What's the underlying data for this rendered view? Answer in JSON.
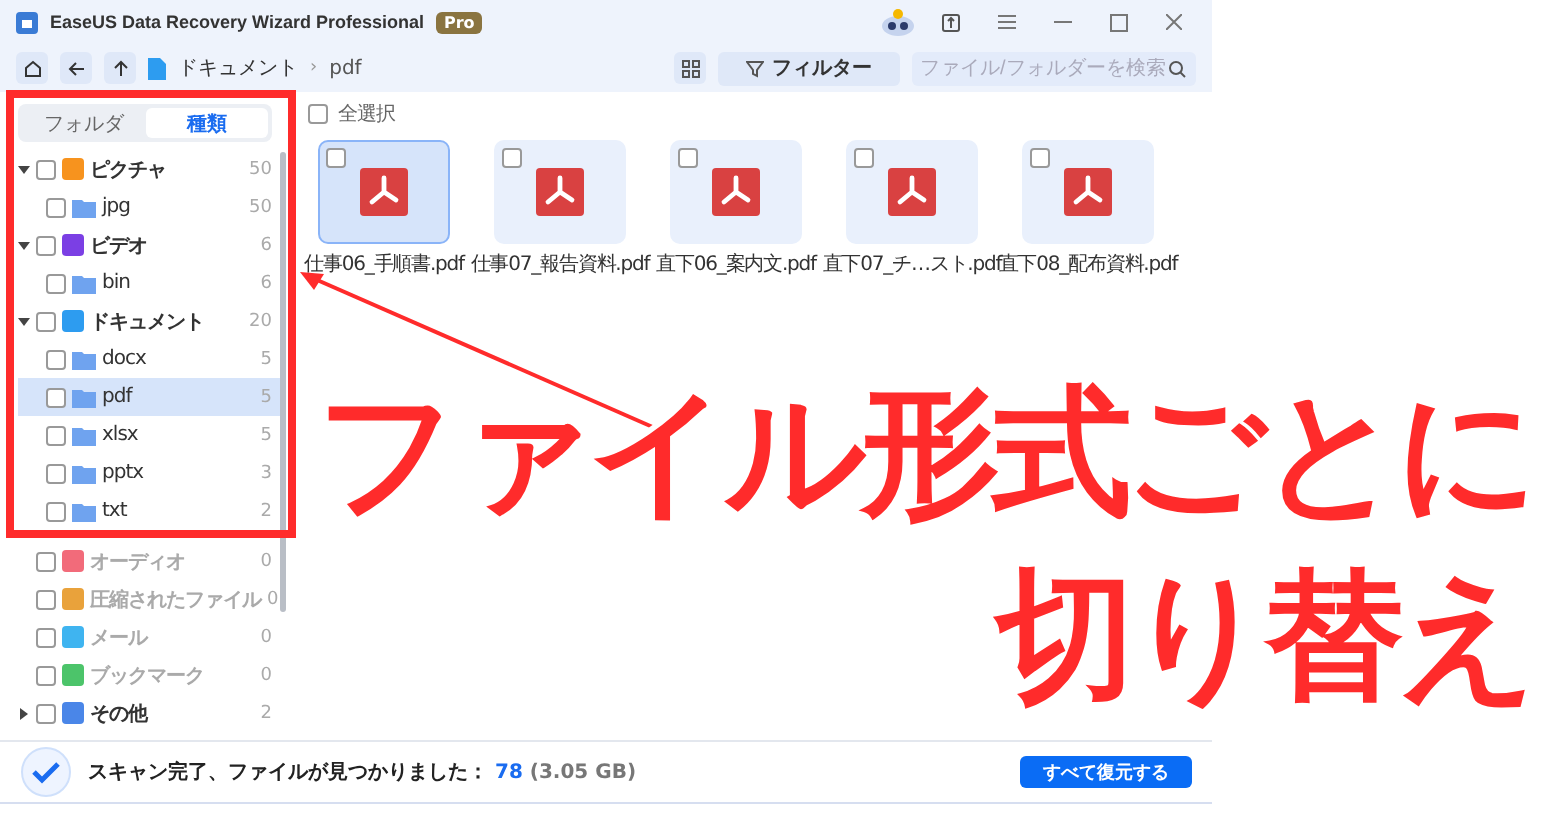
{
  "window": {
    "title": "EaseUS Data Recovery Wizard Professional",
    "badge": "Pro"
  },
  "toolbar": {
    "breadcrumb": [
      "ドキュメント",
      "pdf"
    ],
    "breadcrumb_separator": "›",
    "filter_button": "フィルター",
    "search": {
      "placeholder": "ファイル/フォルダーを検索"
    }
  },
  "sidebar": {
    "tabs": [
      {
        "label": "フォルダ",
        "selected": false
      },
      {
        "label": "種類",
        "selected": true
      }
    ],
    "tree": [
      {
        "label": "ピクチャ",
        "count": "50",
        "color": "#f7931e",
        "expanded": true,
        "checked": false,
        "disabled": false,
        "selected": false,
        "children": [
          {
            "label": "jpg",
            "count": "50",
            "checked": false,
            "selected": false
          }
        ]
      },
      {
        "label": "ビデオ",
        "count": "6",
        "color": "#7b3fe4",
        "expanded": true,
        "checked": false,
        "disabled": false,
        "selected": false,
        "children": [
          {
            "label": "bin",
            "count": "6",
            "checked": false,
            "selected": false
          }
        ]
      },
      {
        "label": "ドキュメント",
        "count": "20",
        "color": "#2d9cf0",
        "expanded": true,
        "checked": false,
        "disabled": false,
        "selected": false,
        "children": [
          {
            "label": "docx",
            "count": "5",
            "checked": false,
            "selected": false
          },
          {
            "label": "pdf",
            "count": "5",
            "checked": false,
            "selected": true
          },
          {
            "label": "xlsx",
            "count": "5",
            "checked": false,
            "selected": false
          },
          {
            "label": "pptx",
            "count": "3",
            "checked": false,
            "selected": false
          },
          {
            "label": "txt",
            "count": "2",
            "checked": false,
            "selected": false
          }
        ]
      },
      {
        "label": "オーディオ",
        "count": "0",
        "color": "#f26b7a",
        "checked": false,
        "disabled": true,
        "selected": false
      },
      {
        "label": "圧縮されたファイル",
        "count": "0",
        "color": "#e9a23b",
        "checked": false,
        "disabled": true,
        "selected": false
      },
      {
        "label": "メール",
        "count": "0",
        "color": "#3fb4f0",
        "checked": false,
        "disabled": true,
        "selected": false
      },
      {
        "label": "ブックマーク",
        "count": "0",
        "color": "#4cc46a",
        "checked": false,
        "disabled": true,
        "selected": false
      },
      {
        "label": "その他",
        "count": "2",
        "color": "#4a86e8",
        "expanded": false,
        "checked": false,
        "disabled": false,
        "selected": false
      }
    ]
  },
  "content": {
    "select_all": {
      "label": "全選択",
      "checked": false
    },
    "files": [
      {
        "name": "仕事06_手順書.pdf",
        "selected": true,
        "checked": false
      },
      {
        "name": "仕事07_報告資料.pdf",
        "selected": false,
        "checked": false
      },
      {
        "name": "直下06_案内文.pdf",
        "selected": false,
        "checked": false
      },
      {
        "name": "直下07_チ…スト.pdf",
        "selected": false,
        "checked": false
      },
      {
        "name": "直下08_配布資料.pdf",
        "selected": false,
        "checked": false
      }
    ]
  },
  "status_bar": {
    "message": "スキャン完了、ファイルが見つかりました：",
    "count": "78",
    "size": "(3.05 GB)",
    "button": "すべて復元する"
  },
  "caption": [
    "ファイル形式ごとに",
    "切り替え"
  ]
}
